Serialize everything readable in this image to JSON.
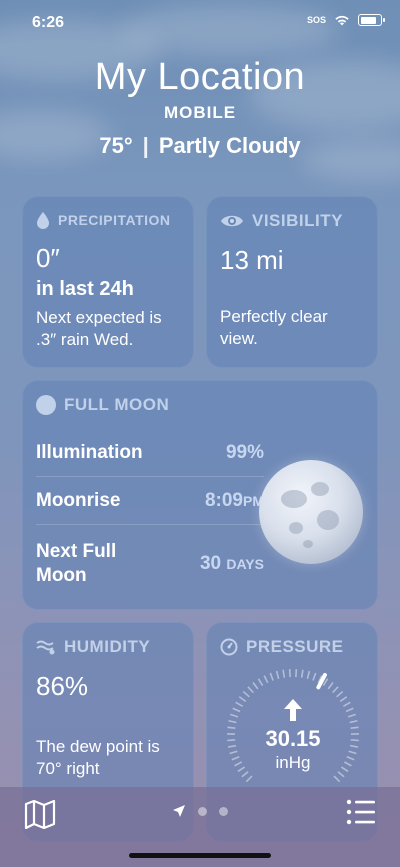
{
  "status": {
    "time": "6:26",
    "sos": "SOS"
  },
  "header": {
    "location": "My Location",
    "subtitle": "MOBILE",
    "temperature": "75°",
    "condition": "Partly Cloudy"
  },
  "precipitation": {
    "title": "PRECIPITATION",
    "icon": "raindrop-icon",
    "value": "0″",
    "period": "in last 24h",
    "note": "Next expected is .3″ rain Wed."
  },
  "visibility": {
    "title": "VISIBILITY",
    "icon": "eye-icon",
    "value": "13 mi",
    "note": "Perfectly clear view."
  },
  "moon": {
    "title": "FULL MOON",
    "icon": "moon-phase-icon",
    "rows": [
      {
        "label": "Illumination",
        "value": "99%",
        "unit": ""
      },
      {
        "label": "Moonrise",
        "value": "8:09",
        "unit": "PM"
      },
      {
        "label": "Next Full Moon",
        "value": "30",
        "unit": "DAYS"
      }
    ]
  },
  "humidity": {
    "title": "HUMIDITY",
    "icon": "humidity-icon",
    "value": "86%",
    "note": "The dew point is 70° right"
  },
  "pressure": {
    "title": "PRESSURE",
    "icon": "gauge-icon",
    "value": "30.15",
    "unit": "inHg",
    "trend_icon": "arrow-up-icon"
  },
  "tab_bar": {
    "map_icon": "map-icon",
    "location_icon": "location-arrow-icon",
    "list_icon": "list-icon",
    "pages": 3,
    "current_page": 0
  },
  "colors": {
    "card": "#6082b4",
    "title_text": "#dce8fa"
  }
}
